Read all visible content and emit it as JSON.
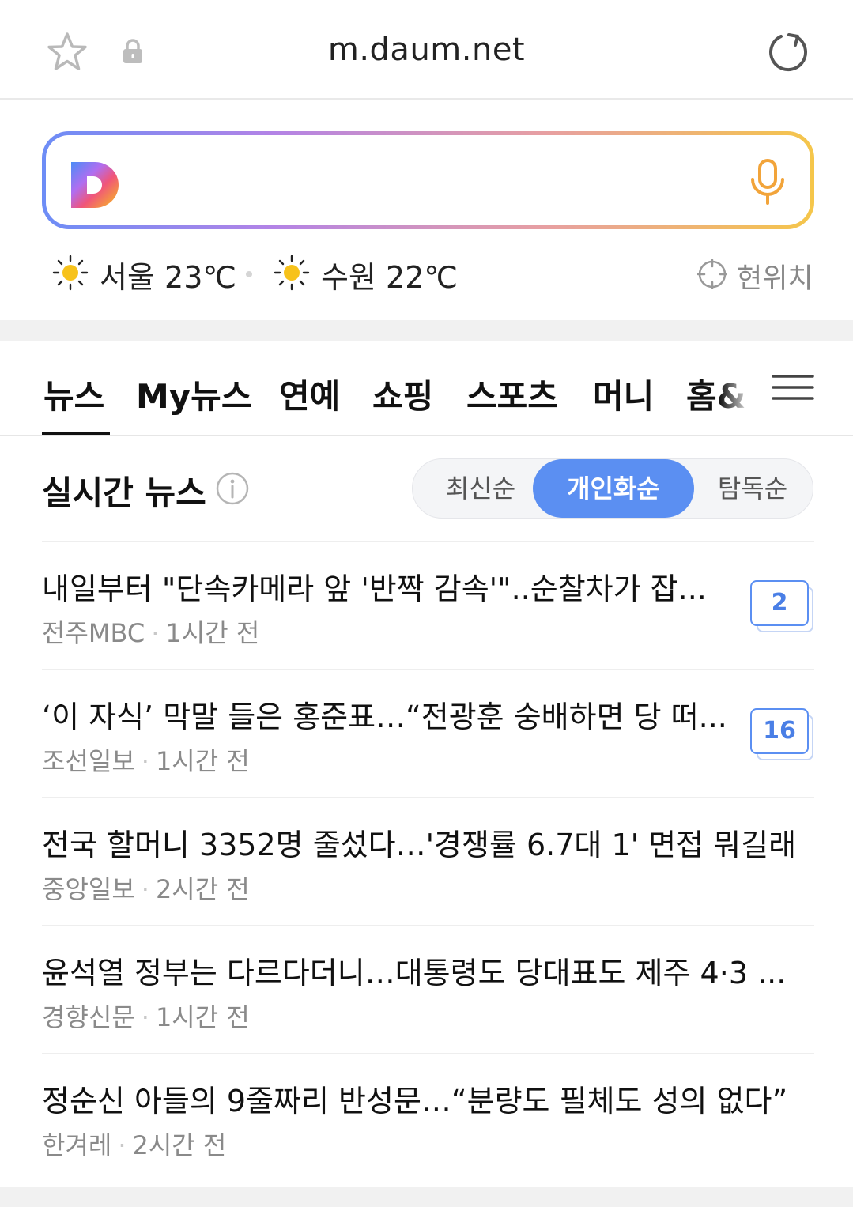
{
  "address_bar": {
    "url": "m.daum.net",
    "icons": [
      "star-icon",
      "lock-icon",
      "reload-icon"
    ]
  },
  "search": {
    "logo": "D",
    "placeholder": "",
    "icons": [
      "daum-logo-icon",
      "mic-icon"
    ],
    "gradient_colors": [
      "#6d8df6",
      "#b383e6",
      "#e79fa2",
      "#f5c64a"
    ]
  },
  "weather": {
    "cities": [
      {
        "name": "서울",
        "temp": "23℃",
        "icon": "sun-icon"
      },
      {
        "name": "수원",
        "temp": "22℃",
        "icon": "sun-icon"
      }
    ],
    "location_label": "현위치",
    "location_icon": "crosshair-icon"
  },
  "tabs": {
    "items": [
      "뉴스",
      "My뉴스",
      "연예",
      "쇼핑",
      "스포츠",
      "머니",
      "홈&"
    ],
    "active": "뉴스",
    "menu_icon": "hamburger-menu-icon"
  },
  "section": {
    "title": "실시간 뉴스",
    "info_icon": "info-icon",
    "sort_options": [
      "최신순",
      "개인화순",
      "탐독순"
    ],
    "active_sort": "개인화순",
    "accent_color": "#5b8ff2"
  },
  "news": [
    {
      "title": "내일부터 \"단속카메라 앞 '반짝 감속'\"..순찰차가 잡...",
      "source": "전주MBC",
      "time": "1시간 전",
      "comments": "2"
    },
    {
      "title": "‘이 자식’ 막말 들은 홍준표…“전광훈 숭배하면 당 떠...",
      "source": "조선일보",
      "time": "1시간 전",
      "comments": "16"
    },
    {
      "title": "전국 할머니 3352명 줄섰다…'경쟁률 6.7대 1' 면접 뭐길래",
      "source": "중앙일보",
      "time": "2시간 전",
      "comments": ""
    },
    {
      "title": "윤석열 정부는 다르다더니…대통령도 당대표도 제주 4·3 ...",
      "source": "경향신문",
      "time": "1시간 전",
      "comments": ""
    },
    {
      "title": "정순신 아들의 9줄짜리 반성문…“분량도 필체도 성의 없다”",
      "source": "한겨레",
      "time": "2시간 전",
      "comments": ""
    }
  ]
}
